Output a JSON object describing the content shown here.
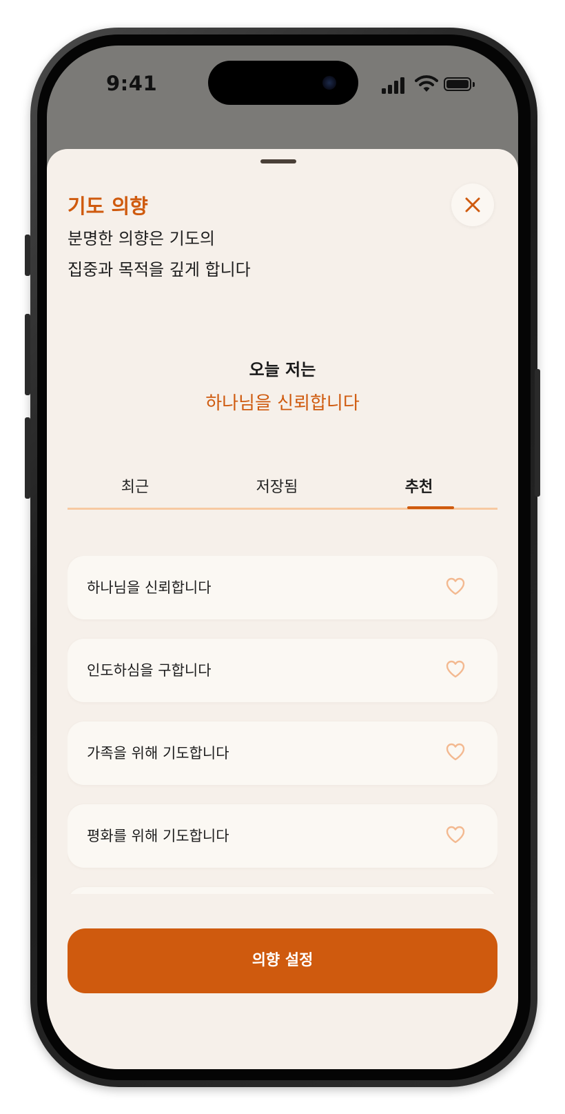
{
  "status_bar": {
    "time": "9:41"
  },
  "sheet": {
    "title": "기도 의향",
    "subtitle_line1": "분명한 의향은 기도의",
    "subtitle_line2": "집중과 목적을 깊게 합니다",
    "today_label": "오늘 저는",
    "today_intention": "하나님을 신뢰합니다"
  },
  "tabs": [
    {
      "label": "최근",
      "selected": false
    },
    {
      "label": "저장됨",
      "selected": false
    },
    {
      "label": "추천",
      "selected": true
    }
  ],
  "intentions": [
    {
      "label": "하나님을 신뢰합니다",
      "favorited": false
    },
    {
      "label": "인도하심을 구합니다",
      "favorited": false
    },
    {
      "label": "가족을 위해 기도합니다",
      "favorited": false
    },
    {
      "label": "평화를 위해 기도합니다",
      "favorited": false
    }
  ],
  "cta": {
    "label": "의향 설정"
  },
  "icons": {
    "close": "close-icon",
    "favorite": "heart-outline-icon"
  },
  "colors": {
    "accent": "#cf5a0e",
    "sheet_background": "#f6f0ea",
    "card_background": "#fbf8f3",
    "heart": "#f3b990",
    "tab_track": "#f7c9a2"
  }
}
